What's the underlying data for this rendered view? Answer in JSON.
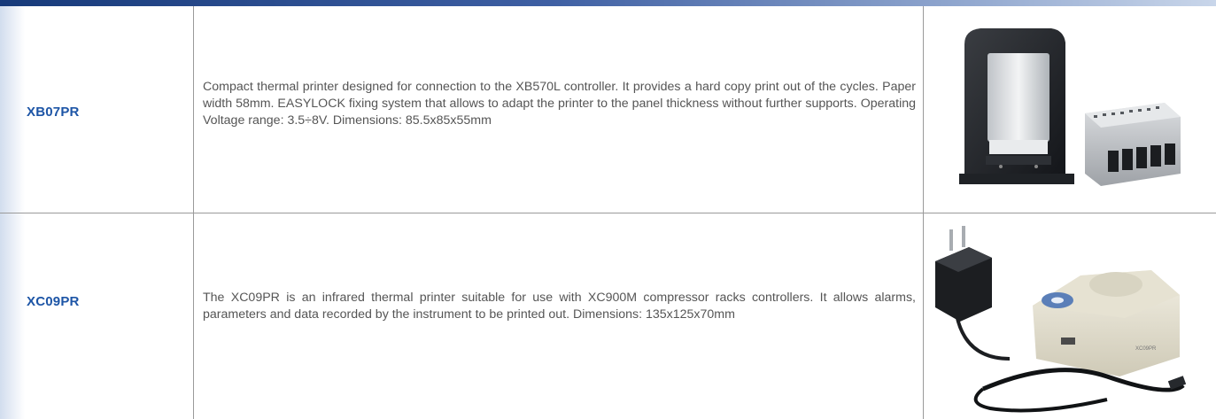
{
  "rows": [
    {
      "code": "XB07PR",
      "description": "Compact thermal printer designed for connection to the XB570L controller. It provides a hard copy print out of the cycles. Paper width 58mm. EASYLOCK fixing system that allows to adapt the printer to the panel thickness without further supports. Operating Voltage range: 3.5÷8V. Dimensions: 85.5x85x55mm",
      "image": "panel-printer-and-power-supply"
    },
    {
      "code": "XC09PR",
      "description": "The XC09PR is an infrared thermal printer suitable for use with XC900M compressor racks controllers. It allows alarms, parameters and data recorded by the instrument to be printed out. Dimensions: 135x125x70mm",
      "image": "desktop-printer-adapter-cable"
    }
  ]
}
